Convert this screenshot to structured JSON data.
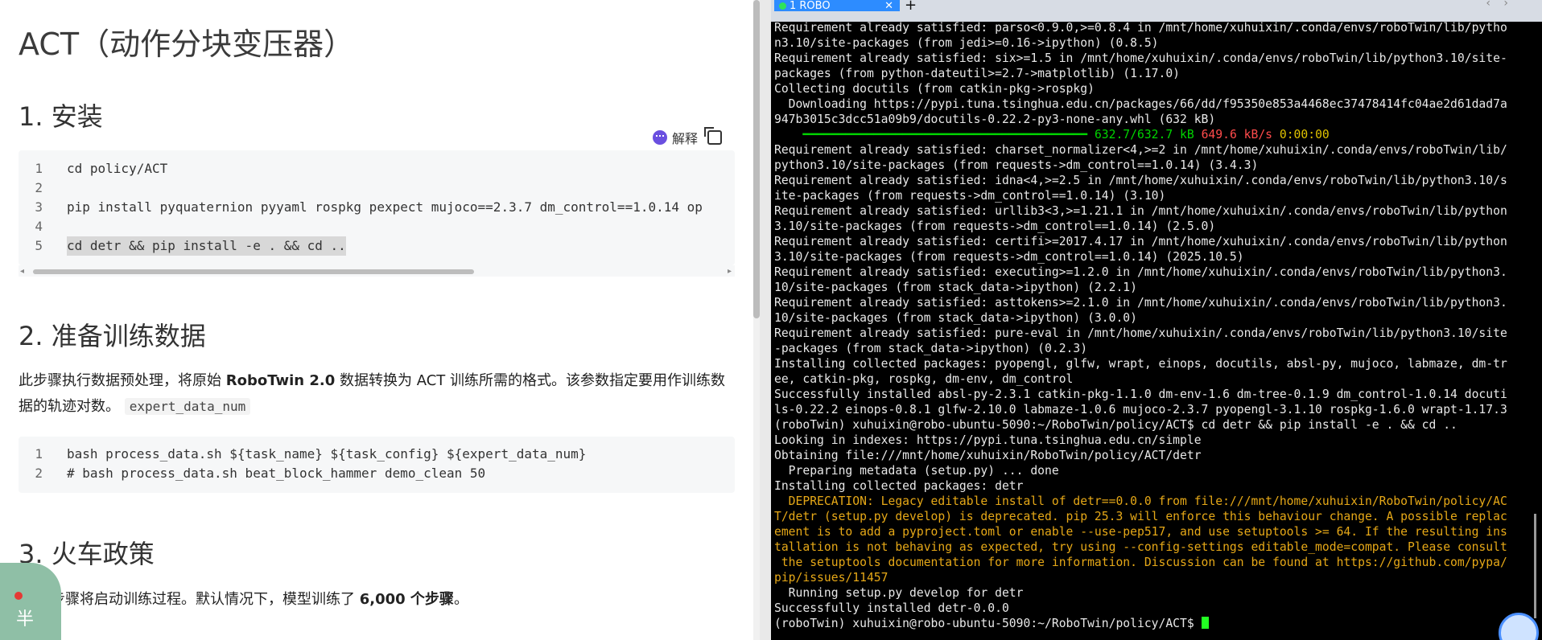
{
  "doc": {
    "title": "ACT（动作分块变压器）",
    "section1": "1. 安装",
    "explain_label": "解释",
    "code1": [
      {
        "n": "1",
        "code": "cd policy/ACT"
      },
      {
        "n": "2",
        "code": ""
      },
      {
        "n": "3",
        "code": "pip install pyquaternion pyyaml rospkg pexpect mujoco==2.3.7 dm_control==1.0.14 op"
      },
      {
        "n": "4",
        "code": ""
      },
      {
        "n": "5",
        "code": "cd detr && pip install -e . && cd .."
      }
    ],
    "section2": "2. 准备训练数据",
    "para2_a": "此步骤执行数据预处理，将原始 ",
    "para2_b": "RoboTwin 2.0",
    "para2_c": " 数据转换为 ACT 训练所需的格式。该参数指定要用作训练数据的轨迹对数。",
    "para2_code": "expert_data_num",
    "code2": [
      {
        "n": "1",
        "code": "bash process_data.sh ${task_name} ${task_config} ${expert_data_num}"
      },
      {
        "n": "2",
        "code": "# bash process_data.sh beat_block_hammer demo_clean 50"
      }
    ],
    "section3": "3. 火车政策",
    "para3_a": "步骤将启动训练过程。默认情况下，模型训练了 ",
    "para3_b": "6,000 个步骤",
    "para3_c": "。",
    "bubble_text": "半"
  },
  "terminal": {
    "tab_title": "1 ROBO",
    "lines": [
      "Requirement already satisfied: parso<0.9.0,>=0.8.4 in /mnt/home/xuhuixin/.conda/envs/roboTwin/lib/pytho",
      "n3.10/site-packages (from jedi>=0.16->ipython) (0.8.5)",
      "Requirement already satisfied: six>=1.5 in /mnt/home/xuhuixin/.conda/envs/roboTwin/lib/python3.10/site-",
      "packages (from python-dateutil>=2.7->matplotlib) (1.17.0)",
      "Collecting docutils (from catkin-pkg->rospkg)",
      "  Downloading https://pypi.tuna.tsinghua.edu.cn/packages/66/dd/f95350e853a4468ec37478414fc04ae2d61dad7a",
      "947b3015c3dcc51a09b9/docutils-0.22.2-py3-none-any.whl (632 kB)",
      "__PROGRESS__",
      "Requirement already satisfied: charset_normalizer<4,>=2 in /mnt/home/xuhuixin/.conda/envs/roboTwin/lib/",
      "python3.10/site-packages (from requests->dm_control==1.0.14) (3.4.3)",
      "Requirement already satisfied: idna<4,>=2.5 in /mnt/home/xuhuixin/.conda/envs/roboTwin/lib/python3.10/s",
      "ite-packages (from requests->dm_control==1.0.14) (3.10)",
      "Requirement already satisfied: urllib3<3,>=1.21.1 in /mnt/home/xuhuixin/.conda/envs/roboTwin/lib/python",
      "3.10/site-packages (from requests->dm_control==1.0.14) (2.5.0)",
      "Requirement already satisfied: certifi>=2017.4.17 in /mnt/home/xuhuixin/.conda/envs/roboTwin/lib/python",
      "3.10/site-packages (from requests->dm_control==1.0.14) (2025.10.5)",
      "Requirement already satisfied: executing>=1.2.0 in /mnt/home/xuhuixin/.conda/envs/roboTwin/lib/python3.",
      "10/site-packages (from stack_data->ipython) (2.2.1)",
      "Requirement already satisfied: asttokens>=2.1.0 in /mnt/home/xuhuixin/.conda/envs/roboTwin/lib/python3.",
      "10/site-packages (from stack_data->ipython) (3.0.0)",
      "Requirement already satisfied: pure-eval in /mnt/home/xuhuixin/.conda/envs/roboTwin/lib/python3.10/site",
      "-packages (from stack_data->ipython) (0.2.3)",
      "Installing collected packages: pyopengl, glfw, wrapt, einops, docutils, absl-py, mujoco, labmaze, dm-tr",
      "ee, catkin-pkg, rospkg, dm-env, dm_control",
      "Successfully installed absl-py-2.3.1 catkin-pkg-1.1.0 dm-env-1.6 dm-tree-0.1.9 dm_control-1.0.14 docuti",
      "ls-0.22.2 einops-0.8.1 glfw-2.10.0 labmaze-1.0.6 mujoco-2.3.7 pyopengl-3.1.10 rospkg-1.6.0 wrapt-1.17.3",
      "(roboTwin) xuhuixin@robo-ubuntu-5090:~/RoboTwin/policy/ACT$ cd detr && pip install -e . && cd ..",
      "Looking in indexes: https://pypi.tuna.tsinghua.edu.cn/simple",
      "Obtaining file:///mnt/home/xuhuixin/RoboTwin/policy/ACT/detr",
      "  Preparing metadata (setup.py) ... done",
      "Installing collected packages: detr",
      "  DEPRECATION: Legacy editable install of detr==0.0.0 from file:///mnt/home/xuhuixin/RoboTwin/policy/AC",
      "T/detr (setup.py develop) is deprecated. pip 25.3 will enforce this behaviour change. A possible replac",
      "ement is to add a pyproject.toml or enable --use-pep517, and use setuptools >= 64. If the resulting ins",
      "tallation is not behaving as expected, try using --config-settings editable_mode=compat. Please consult",
      " the setuptools documentation for more information. Discussion can be found at https://github.com/pypa/",
      "pip/issues/11457",
      "  Running setup.py develop for detr",
      "Successfully installed detr-0.0.0",
      "(roboTwin) xuhuixin@robo-ubuntu-5090:~/RoboTwin/policy/ACT$ "
    ],
    "progress": {
      "bar": "━━━━━━━━━━━━━━━━━━━━━━━━━━━━━━━━━━━━━━━━",
      "size": "632.7/632.7 kB",
      "speed": "649.6 kB/s",
      "eta": "0:00:00"
    },
    "deprecation_line_indices": [
      31,
      32,
      33,
      34,
      35,
      36
    ]
  }
}
